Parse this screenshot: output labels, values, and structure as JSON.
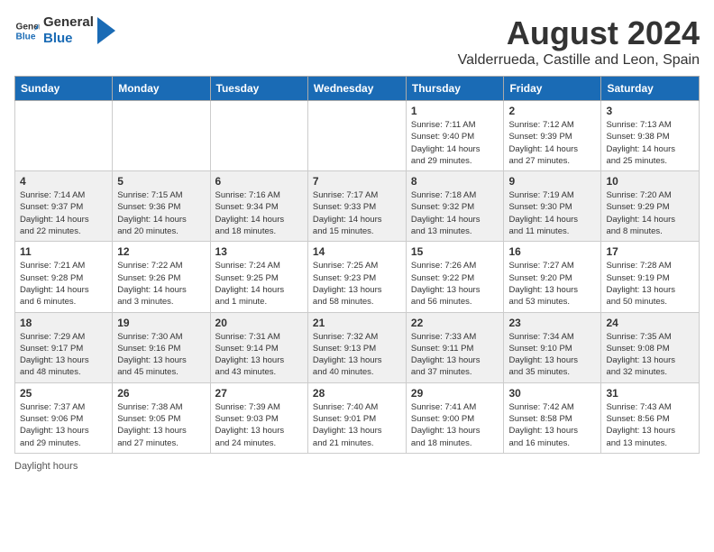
{
  "header": {
    "logo_line1": "General",
    "logo_line2": "Blue",
    "title": "August 2024",
    "location": "Valderrueda, Castille and Leon, Spain"
  },
  "columns": [
    "Sunday",
    "Monday",
    "Tuesday",
    "Wednesday",
    "Thursday",
    "Friday",
    "Saturday"
  ],
  "weeks": [
    [
      {
        "day": "",
        "info": ""
      },
      {
        "day": "",
        "info": ""
      },
      {
        "day": "",
        "info": ""
      },
      {
        "day": "",
        "info": ""
      },
      {
        "day": "1",
        "info": "Sunrise: 7:11 AM\nSunset: 9:40 PM\nDaylight: 14 hours\nand 29 minutes."
      },
      {
        "day": "2",
        "info": "Sunrise: 7:12 AM\nSunset: 9:39 PM\nDaylight: 14 hours\nand 27 minutes."
      },
      {
        "day": "3",
        "info": "Sunrise: 7:13 AM\nSunset: 9:38 PM\nDaylight: 14 hours\nand 25 minutes."
      }
    ],
    [
      {
        "day": "4",
        "info": "Sunrise: 7:14 AM\nSunset: 9:37 PM\nDaylight: 14 hours\nand 22 minutes."
      },
      {
        "day": "5",
        "info": "Sunrise: 7:15 AM\nSunset: 9:36 PM\nDaylight: 14 hours\nand 20 minutes."
      },
      {
        "day": "6",
        "info": "Sunrise: 7:16 AM\nSunset: 9:34 PM\nDaylight: 14 hours\nand 18 minutes."
      },
      {
        "day": "7",
        "info": "Sunrise: 7:17 AM\nSunset: 9:33 PM\nDaylight: 14 hours\nand 15 minutes."
      },
      {
        "day": "8",
        "info": "Sunrise: 7:18 AM\nSunset: 9:32 PM\nDaylight: 14 hours\nand 13 minutes."
      },
      {
        "day": "9",
        "info": "Sunrise: 7:19 AM\nSunset: 9:30 PM\nDaylight: 14 hours\nand 11 minutes."
      },
      {
        "day": "10",
        "info": "Sunrise: 7:20 AM\nSunset: 9:29 PM\nDaylight: 14 hours\nand 8 minutes."
      }
    ],
    [
      {
        "day": "11",
        "info": "Sunrise: 7:21 AM\nSunset: 9:28 PM\nDaylight: 14 hours\nand 6 minutes."
      },
      {
        "day": "12",
        "info": "Sunrise: 7:22 AM\nSunset: 9:26 PM\nDaylight: 14 hours\nand 3 minutes."
      },
      {
        "day": "13",
        "info": "Sunrise: 7:24 AM\nSunset: 9:25 PM\nDaylight: 14 hours\nand 1 minute."
      },
      {
        "day": "14",
        "info": "Sunrise: 7:25 AM\nSunset: 9:23 PM\nDaylight: 13 hours\nand 58 minutes."
      },
      {
        "day": "15",
        "info": "Sunrise: 7:26 AM\nSunset: 9:22 PM\nDaylight: 13 hours\nand 56 minutes."
      },
      {
        "day": "16",
        "info": "Sunrise: 7:27 AM\nSunset: 9:20 PM\nDaylight: 13 hours\nand 53 minutes."
      },
      {
        "day": "17",
        "info": "Sunrise: 7:28 AM\nSunset: 9:19 PM\nDaylight: 13 hours\nand 50 minutes."
      }
    ],
    [
      {
        "day": "18",
        "info": "Sunrise: 7:29 AM\nSunset: 9:17 PM\nDaylight: 13 hours\nand 48 minutes."
      },
      {
        "day": "19",
        "info": "Sunrise: 7:30 AM\nSunset: 9:16 PM\nDaylight: 13 hours\nand 45 minutes."
      },
      {
        "day": "20",
        "info": "Sunrise: 7:31 AM\nSunset: 9:14 PM\nDaylight: 13 hours\nand 43 minutes."
      },
      {
        "day": "21",
        "info": "Sunrise: 7:32 AM\nSunset: 9:13 PM\nDaylight: 13 hours\nand 40 minutes."
      },
      {
        "day": "22",
        "info": "Sunrise: 7:33 AM\nSunset: 9:11 PM\nDaylight: 13 hours\nand 37 minutes."
      },
      {
        "day": "23",
        "info": "Sunrise: 7:34 AM\nSunset: 9:10 PM\nDaylight: 13 hours\nand 35 minutes."
      },
      {
        "day": "24",
        "info": "Sunrise: 7:35 AM\nSunset: 9:08 PM\nDaylight: 13 hours\nand 32 minutes."
      }
    ],
    [
      {
        "day": "25",
        "info": "Sunrise: 7:37 AM\nSunset: 9:06 PM\nDaylight: 13 hours\nand 29 minutes."
      },
      {
        "day": "26",
        "info": "Sunrise: 7:38 AM\nSunset: 9:05 PM\nDaylight: 13 hours\nand 27 minutes."
      },
      {
        "day": "27",
        "info": "Sunrise: 7:39 AM\nSunset: 9:03 PM\nDaylight: 13 hours\nand 24 minutes."
      },
      {
        "day": "28",
        "info": "Sunrise: 7:40 AM\nSunset: 9:01 PM\nDaylight: 13 hours\nand 21 minutes."
      },
      {
        "day": "29",
        "info": "Sunrise: 7:41 AM\nSunset: 9:00 PM\nDaylight: 13 hours\nand 18 minutes."
      },
      {
        "day": "30",
        "info": "Sunrise: 7:42 AM\nSunset: 8:58 PM\nDaylight: 13 hours\nand 16 minutes."
      },
      {
        "day": "31",
        "info": "Sunrise: 7:43 AM\nSunset: 8:56 PM\nDaylight: 13 hours\nand 13 minutes."
      }
    ]
  ],
  "footer": {
    "daylight_label": "Daylight hours"
  }
}
